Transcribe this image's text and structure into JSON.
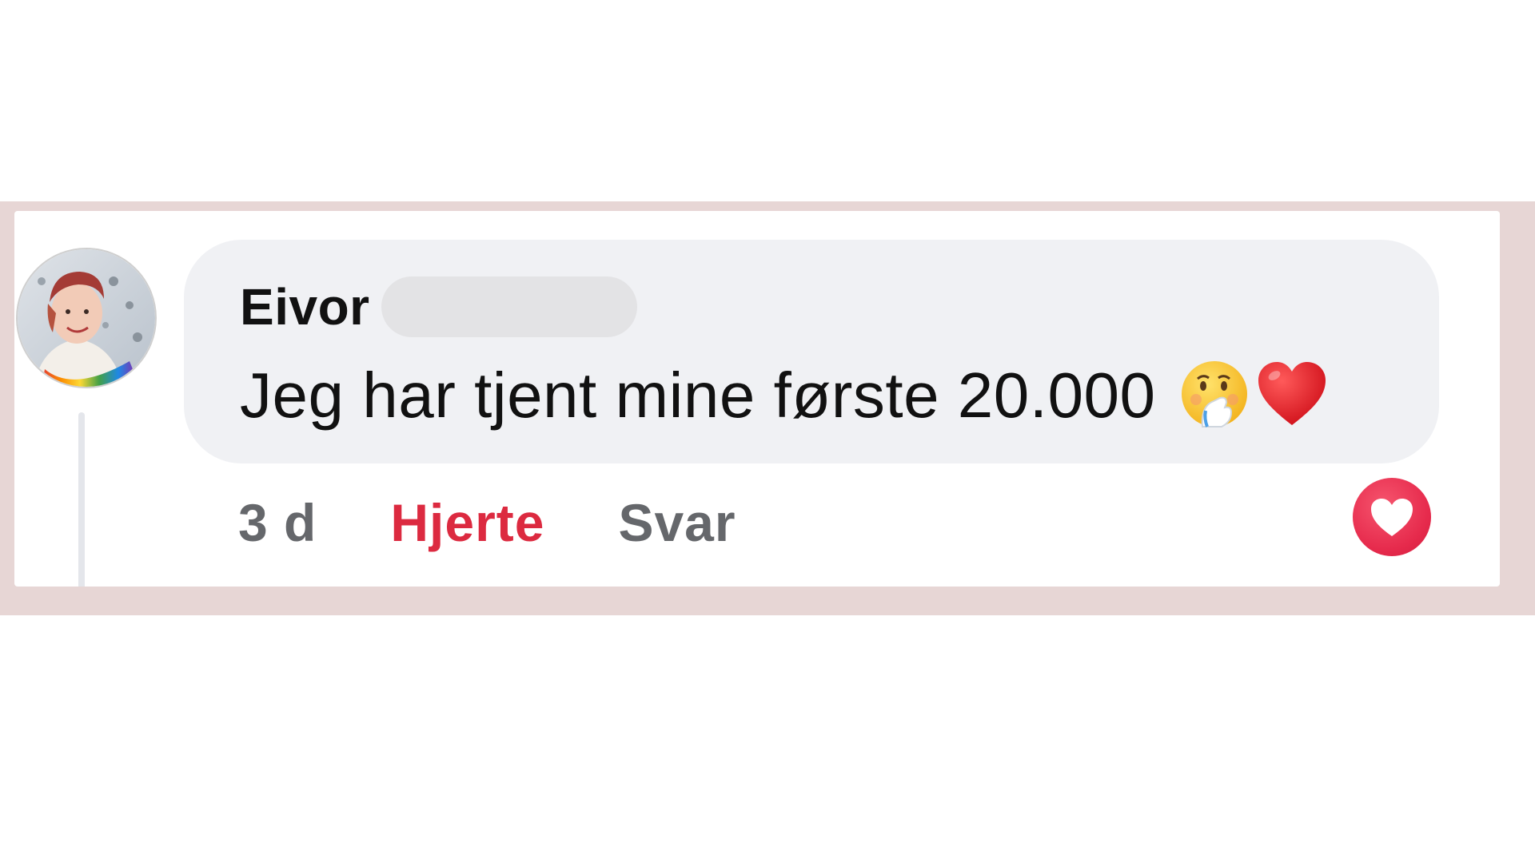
{
  "comment": {
    "author": "Eivor",
    "text": "Jeg har tjent mine første 20.000",
    "emojis": [
      "face-with-hand-over-mouth-icon",
      "red-heart-icon"
    ]
  },
  "actions": {
    "time": "3 d",
    "love": "Hjerte",
    "reply": "Svar"
  },
  "reaction": {
    "icon": "heart-reaction-icon",
    "color": "#e62a4c"
  },
  "colors": {
    "background_band": "#e7d6d5",
    "bubble": "#f0f1f4",
    "love_text": "#dc2a40",
    "muted_text": "#65676b"
  }
}
